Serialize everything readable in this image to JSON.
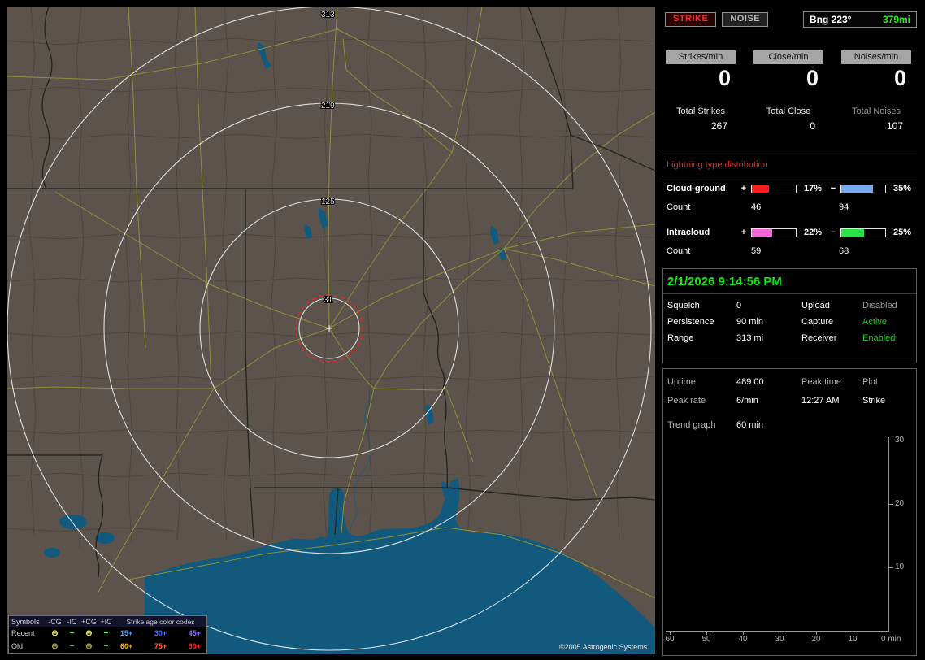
{
  "map": {
    "ring_labels": [
      "313",
      "219",
      "125",
      "31"
    ],
    "copyright": "©2005 Astrogenic Systems",
    "legend": {
      "symbols_header": "Symbols",
      "symbol_cols": [
        "-CG",
        "-IC",
        "+CG",
        "+IC"
      ],
      "age_header": "Strike age color codes",
      "rows": [
        {
          "label": "Recent",
          "symbols": [
            "⊖",
            "−",
            "⊕",
            "+"
          ],
          "symbol_colors": [
            "#e8e860",
            "#7de87d",
            "#e8e860",
            "#7de87d"
          ],
          "ages": [
            "15+",
            "30+",
            "45+"
          ],
          "age_colors": [
            "#58aaff",
            "#4d6bff",
            "#9b6bff"
          ]
        },
        {
          "label": "Old",
          "symbols": [
            "⊖",
            "−",
            "⊕",
            "+"
          ],
          "symbol_colors": [
            "#b0a040",
            "#6aa86a",
            "#b0a040",
            "#6aa86a"
          ],
          "ages": [
            "60+",
            "75+",
            "90+"
          ],
          "age_colors": [
            "#ffb020",
            "#ff6430",
            "#ff2828"
          ]
        }
      ]
    }
  },
  "panel": {
    "strike_button": "STRIKE",
    "noise_button": "NOISE",
    "bearing_label": "Bng 223°",
    "bearing_range": "379mi",
    "bearing_range_color": "#30e830",
    "rates": [
      {
        "label": "Strikes/min",
        "value": "0"
      },
      {
        "label": "Close/min",
        "value": "0"
      },
      {
        "label": "Noises/min",
        "value": "0"
      }
    ],
    "totals": [
      {
        "label": "Total Strikes",
        "value": "267"
      },
      {
        "label": "Total Close",
        "value": "0"
      },
      {
        "label": "Total Noises",
        "value": "107"
      }
    ],
    "distribution": {
      "title": "Lightning type distribution",
      "title_color": "#d03030",
      "count_label": "Count",
      "rows": [
        {
          "label": "Cloud-ground",
          "plus_sign": "+",
          "minus_sign": "−",
          "plus_pct": "17%",
          "minus_pct": "35%",
          "plus_count": "46",
          "minus_count": "94",
          "plus_color": "#ff1e1e",
          "minus_color": "#79aaf0",
          "plus_fill": "38%",
          "minus_fill": "72%"
        },
        {
          "label": "Intracloud",
          "plus_sign": "+",
          "minus_sign": "−",
          "plus_pct": "22%",
          "minus_pct": "25%",
          "plus_count": "59",
          "minus_count": "68",
          "plus_color": "#f06ad8",
          "minus_color": "#2ae246",
          "plus_fill": "46%",
          "minus_fill": "52%"
        }
      ]
    },
    "datetime": "2/1/2026 9:14:56 PM",
    "datetime_color": "#12e812",
    "settings": [
      {
        "label": "Squelch",
        "value": "0",
        "label2": "Upload",
        "value2": "Disabled",
        "value2_color": "#9a9a9a"
      },
      {
        "label": "Persistence",
        "value": "90 min",
        "label2": "Capture",
        "value2": "Active",
        "value2_color": "#12d812"
      },
      {
        "label": "Range",
        "value": "313 mi",
        "label2": "Receiver",
        "value2": "Enabled",
        "value2_color": "#12d812"
      }
    ],
    "stats": {
      "uptime_label": "Uptime",
      "uptime_value": "489:00",
      "peak_time_label": "Peak time",
      "plot_label": "Plot",
      "peak_rate_label": "Peak rate",
      "peak_rate_value": "6/min",
      "peak_time_value": "12:27 AM",
      "plot_value": "Strike",
      "trend_label": "Trend graph",
      "trend_value": "60 min"
    },
    "trend": {
      "y_ticks": [
        "30",
        "20",
        "10"
      ],
      "x_ticks": [
        "60",
        "50",
        "40",
        "30",
        "20",
        "10"
      ],
      "x_end_label": "0 min"
    }
  }
}
